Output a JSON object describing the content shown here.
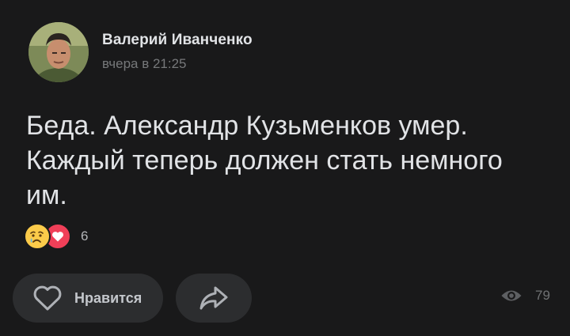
{
  "post": {
    "author": {
      "name": "Валерий Иванченко",
      "avatar_icon": "avatar-photo"
    },
    "time": "вчера в 21:25",
    "text_lines": [
      "Беда. Александр Кузьменков умер.",
      "Каждый теперь должен стать немного",
      "им."
    ],
    "reactions": {
      "icons": [
        "crying-face-icon",
        "heart-icon"
      ],
      "count": "6"
    }
  },
  "actions": {
    "like_label": "Нравится",
    "like_icon": "heart-outline-icon",
    "share_icon": "share-arrow-icon"
  },
  "views": {
    "icon": "eye-icon",
    "count": "79"
  },
  "colors": {
    "background": "#19191a",
    "button_bg": "#2c2d2f",
    "text_primary": "#e1e3e6",
    "text_secondary": "#76787a",
    "heart_red": "#f03f58",
    "emoji_yellow": "#fbcb4a"
  }
}
